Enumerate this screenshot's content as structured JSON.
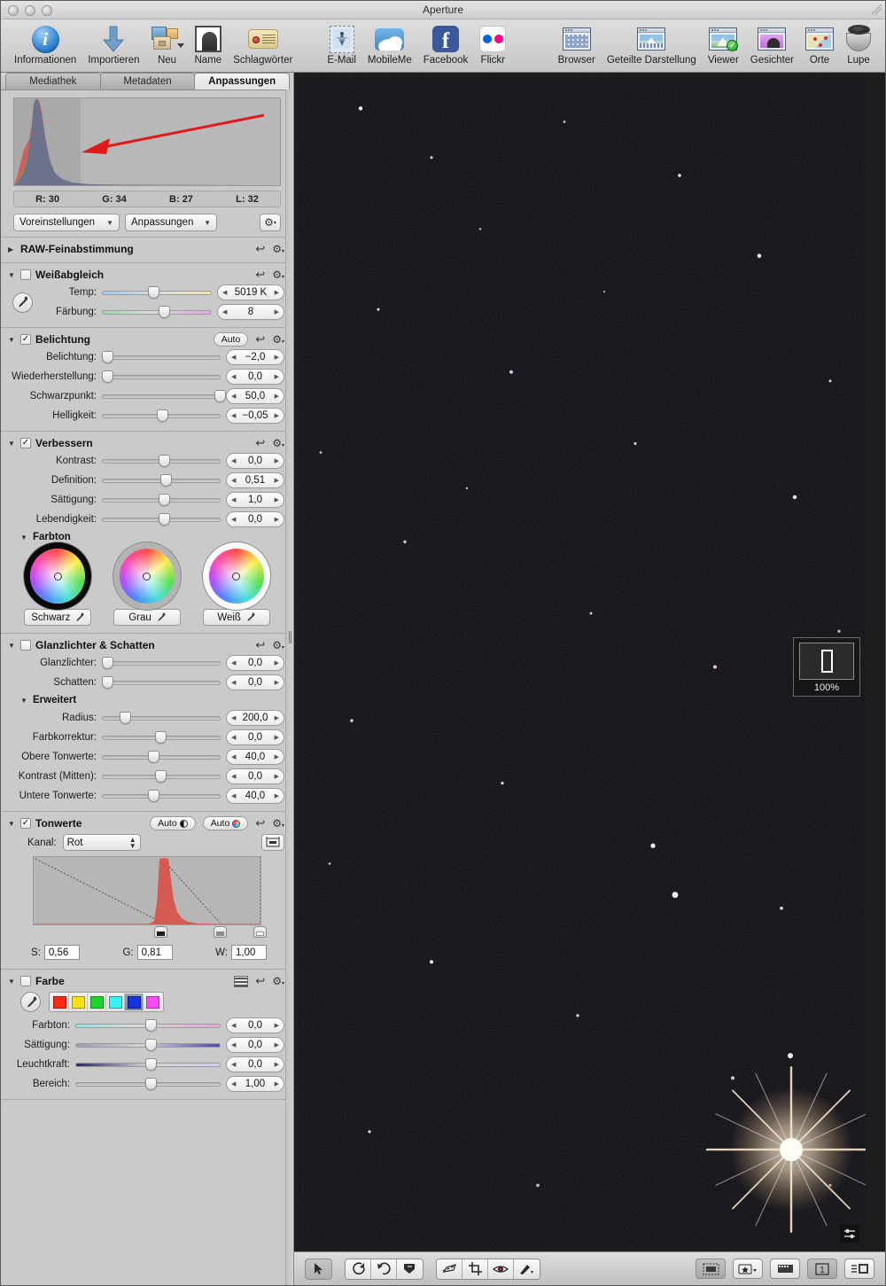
{
  "window": {
    "title": "Aperture"
  },
  "toolbar": {
    "left_items": [
      {
        "label": "Informationen",
        "icon": "info-icon"
      },
      {
        "label": "Importieren",
        "icon": "import-arrow-icon"
      },
      {
        "label": "Neu",
        "icon": "new-project-icon"
      },
      {
        "label": "Name",
        "icon": "name-face-icon"
      },
      {
        "label": "Schlagwörter",
        "icon": "keyword-tag-icon"
      },
      {
        "label": "E-Mail",
        "icon": "email-stamp-icon"
      },
      {
        "label": "MobileMe",
        "icon": "mobileme-cloud-icon"
      },
      {
        "label": "Facebook",
        "icon": "facebook-icon"
      },
      {
        "label": "Flickr",
        "icon": "flickr-icon"
      }
    ],
    "right_items": [
      {
        "label": "Browser",
        "icon": "browser-grid-icon"
      },
      {
        "label": "Geteilte Darstellung",
        "icon": "split-view-icon"
      },
      {
        "label": "Viewer",
        "icon": "viewer-icon"
      },
      {
        "label": "Gesichter",
        "icon": "faces-icon"
      },
      {
        "label": "Orte",
        "icon": "places-map-icon"
      },
      {
        "label": "Lupe",
        "icon": "loupe-icon"
      }
    ]
  },
  "inspector": {
    "tabs": [
      {
        "label": "Mediathek",
        "active": false
      },
      {
        "label": "Metadaten",
        "active": false
      },
      {
        "label": "Anpassungen",
        "active": true
      }
    ],
    "histogram": {
      "readout": [
        {
          "label": "R:",
          "value": "30"
        },
        {
          "label": "G:",
          "value": "34"
        },
        {
          "label": "B:",
          "value": "27"
        },
        {
          "label": "L:",
          "value": "32"
        }
      ]
    },
    "presets_button": "Voreinstellungen",
    "adjustments_button": "Anpassungen",
    "gear_glyph": "⚙",
    "sections": {
      "raw": {
        "title": "RAW-Feinabstimmung",
        "expanded": false,
        "checkbox": null
      },
      "white_balance": {
        "title": "Weißabgleich",
        "checked": false,
        "rows": [
          {
            "label": "Temp:",
            "value": "5019 K",
            "pos": 42,
            "track": "temp"
          },
          {
            "label": "Färbung:",
            "value": "8",
            "pos": 52,
            "track": "tint"
          }
        ]
      },
      "exposure": {
        "title": "Belichtung",
        "checked": true,
        "auto_label": "Auto",
        "rows": [
          {
            "label": "Belichtung:",
            "value": "−2,0",
            "pos": 1,
            "track": "plain"
          },
          {
            "label": "Wiederherstellung:",
            "value": "0,0",
            "pos": 1,
            "track": "plain"
          },
          {
            "label": "Schwarzpunkt:",
            "value": "50,0",
            "pos": 96,
            "track": "plain"
          },
          {
            "label": "Helligkeit:",
            "value": "−0,05",
            "pos": 47,
            "track": "plain"
          }
        ]
      },
      "enhance": {
        "title": "Verbessern",
        "checked": true,
        "rows": [
          {
            "label": "Kontrast:",
            "value": "0,0",
            "pos": 49,
            "track": "plain"
          },
          {
            "label": "Definition:",
            "value": "0,51",
            "pos": 50,
            "track": "plain"
          },
          {
            "label": "Sättigung:",
            "value": "1,0",
            "pos": 49,
            "track": "plain"
          },
          {
            "label": "Lebendigkeit:",
            "value": "0,0",
            "pos": 49,
            "track": "plain"
          }
        ],
        "tint_subhead": "Farbton",
        "wheels": [
          {
            "label": "Schwarz",
            "kind": "k"
          },
          {
            "label": "Grau",
            "kind": "g"
          },
          {
            "label": "Weiß",
            "kind": "w"
          }
        ]
      },
      "highlights_shadows": {
        "title": "Glanzlichter & Schatten",
        "checked": false,
        "rows": [
          {
            "label": "Glanzlichter:",
            "value": "0,0",
            "pos": 1,
            "track": "plain"
          },
          {
            "label": "Schatten:",
            "value": "0,0",
            "pos": 1,
            "track": "plain"
          }
        ],
        "advanced_subhead": "Erweitert",
        "advanced_rows": [
          {
            "label": "Radius:",
            "value": "200,0",
            "pos": 16,
            "track": "plain"
          },
          {
            "label": "Farbkorrektur:",
            "value": "0,0",
            "pos": 46,
            "track": "plain"
          },
          {
            "label": "Obere Tonwerte:",
            "value": "40,0",
            "pos": 40,
            "track": "plain"
          },
          {
            "label": "Kontrast (Mitten):",
            "value": "0,0",
            "pos": 46,
            "track": "plain"
          },
          {
            "label": "Untere Tonwerte:",
            "value": "40,0",
            "pos": 40,
            "track": "plain"
          }
        ]
      },
      "levels": {
        "title": "Tonwerte",
        "checked": true,
        "auto_luma_label": "Auto",
        "auto_rgb_label": "Auto",
        "channel_label": "Kanal:",
        "channel_value": "Rot",
        "fields": [
          {
            "label": "S:",
            "value": "0,56"
          },
          {
            "label": "G:",
            "value": "0,81"
          },
          {
            "label": "W:",
            "value": "1,00"
          }
        ],
        "marker_positions": {
          "black": 56,
          "gray": 81,
          "white": 99
        }
      },
      "color": {
        "title": "Farbe",
        "checked": false,
        "swatches": [
          "#ff2a16",
          "#f5e216",
          "#1fd42b",
          "#3bf1f1",
          "#1733e0",
          "#f54df5"
        ],
        "selected_swatch_index": 4,
        "rows": [
          {
            "label": "Farbton:",
            "value": "0,0",
            "pos": 49,
            "track": "hue"
          },
          {
            "label": "Sättigung:",
            "value": "0,0",
            "pos": 49,
            "track": "sat2"
          },
          {
            "label": "Leuchtkraft:",
            "value": "0,0",
            "pos": 49,
            "track": "lum"
          },
          {
            "label": "Bereich:",
            "value": "1,00",
            "pos": 49,
            "track": "plain"
          }
        ]
      }
    }
  },
  "viewer": {
    "zoom_percent": "100%",
    "toolbar_left": [
      {
        "icon": "selection-arrow-icon",
        "active": true
      },
      {
        "icon": "rotate-left-icon",
        "active": false
      },
      {
        "icon": "rotate-right-icon",
        "active": false
      },
      {
        "icon": "flag-down-icon",
        "active": false
      },
      {
        "icon": "straighten-icon",
        "active": false
      },
      {
        "icon": "crop-icon",
        "active": false
      },
      {
        "icon": "red-eye-icon",
        "active": false
      },
      {
        "icon": "retouch-brush-icon",
        "active": false
      }
    ],
    "toolbar_right": [
      {
        "icon": "show-metadata-icon",
        "active": true
      },
      {
        "icon": "rating-badge-icon",
        "active": false
      },
      {
        "icon": "filmstrip-icon",
        "active": false
      },
      {
        "icon": "primary-only-icon",
        "active": true,
        "label": "1"
      },
      {
        "icon": "inspector-toggle-icon",
        "active": false
      }
    ]
  }
}
